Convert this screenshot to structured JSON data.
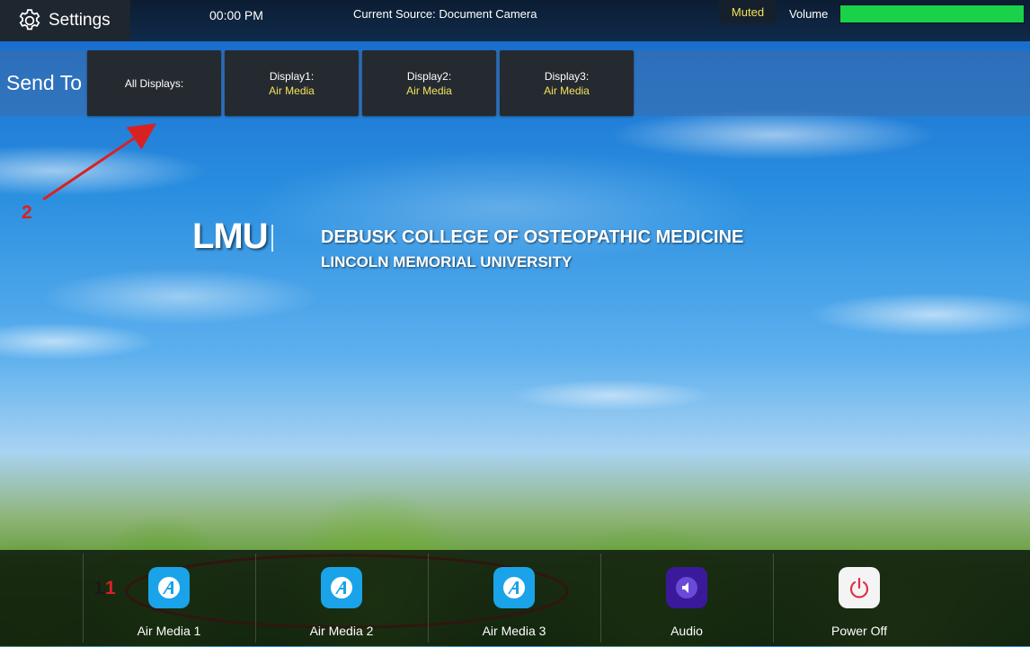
{
  "topbar": {
    "settings_label": "Settings",
    "time": "00:00 PM",
    "current_source": "Current Source: Document Camera",
    "muted_label": "Muted",
    "volume_label": "Volume",
    "volume_level": 1.0
  },
  "sendto": {
    "label": "Send To",
    "buttons": [
      {
        "name": "All Displays:",
        "source": ""
      },
      {
        "name": "Display1:",
        "source": "Air Media"
      },
      {
        "name": "Display2:",
        "source": "Air Media"
      },
      {
        "name": "Display3:",
        "source": "Air Media"
      }
    ]
  },
  "logo": {
    "mark": "LMU",
    "college": "DEBUSK COLLEGE OF OSTEOPATHIC MEDICINE",
    "university": "LINCOLN MEMORIAL UNIVERSITY"
  },
  "annotations": {
    "label_2": "2",
    "label_1a": "1",
    "label_1b": "1",
    "color": "#d82222"
  },
  "bottombar": {
    "tiles": [
      {
        "label": "Air Media 1",
        "icon": "air-media-icon",
        "color": "#1aa3e8"
      },
      {
        "label": "Air Media 2",
        "icon": "air-media-icon",
        "color": "#1aa3e8"
      },
      {
        "label": "Air Media 3",
        "icon": "air-media-icon",
        "color": "#1aa3e8"
      },
      {
        "label": "Audio",
        "icon": "speaker-icon",
        "color": "#3a1a9a"
      },
      {
        "label": "Power Off",
        "icon": "power-icon",
        "color": "#f4f4f4"
      }
    ]
  },
  "colors": {
    "accent_yellow": "#f2e35a",
    "volume_green": "#1ad24a",
    "button_dark": "#252a31"
  }
}
